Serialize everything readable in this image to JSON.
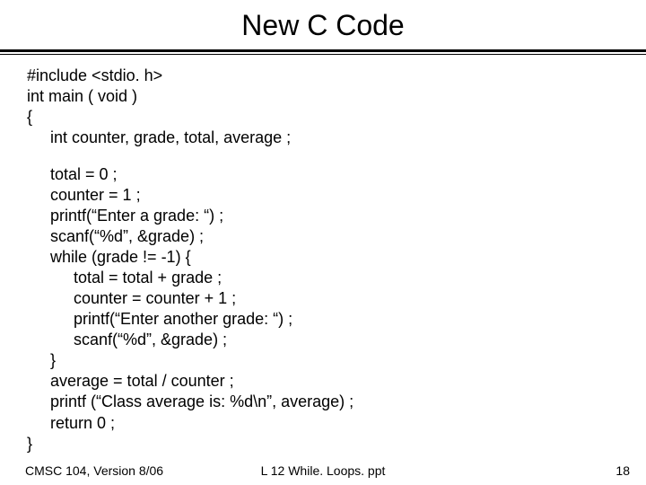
{
  "title": "New C Code",
  "code": {
    "l1": "#include <stdio. h>",
    "l2": "int main ( void )",
    "l3": "{",
    "l4": "int counter, grade, total, average ;",
    "l5": "total = 0 ;",
    "l6": "counter = 1 ;",
    "l7": "printf(“Enter a grade: “) ;",
    "l8": "scanf(“%d”, &grade) ;",
    "l9": "while (grade != -1) {",
    "l10": "total = total + grade ;",
    "l11": "counter = counter + 1 ;",
    "l12": "printf(“Enter another grade: “) ;",
    "l13": "scanf(“%d”, &grade) ;",
    "l14": "}",
    "l15": "average = total / counter ;",
    "l16": "printf (“Class average is: %d\\n”, average) ;",
    "l17": "return 0 ;",
    "l18": "}"
  },
  "footer": {
    "left": "CMSC 104, Version 8/06",
    "center": "L 12 While. Loops. ppt",
    "right": "18"
  }
}
